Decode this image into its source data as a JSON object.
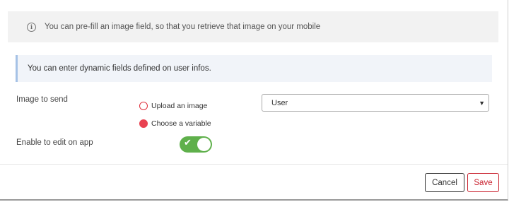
{
  "info_banner": {
    "icon": "info-circle-icon",
    "text": "You can pre-fill an image field, so that you retrieve that image on your mobile"
  },
  "note": {
    "text": "You can enter dynamic fields defined on user infos."
  },
  "image_field": {
    "label": "Image to send",
    "options": [
      {
        "label": "Upload an image",
        "selected": false
      },
      {
        "label": "Choose a variable",
        "selected": true
      }
    ],
    "variable_select": {
      "value": "User"
    }
  },
  "edit_field": {
    "label": "Enable to edit on app",
    "enabled": true
  },
  "footer": {
    "cancel_label": "Cancel",
    "save_label": "Save"
  },
  "colors": {
    "accent_red": "#e94251",
    "toggle_green": "#5fb04b",
    "note_border": "#a6c2e6"
  }
}
